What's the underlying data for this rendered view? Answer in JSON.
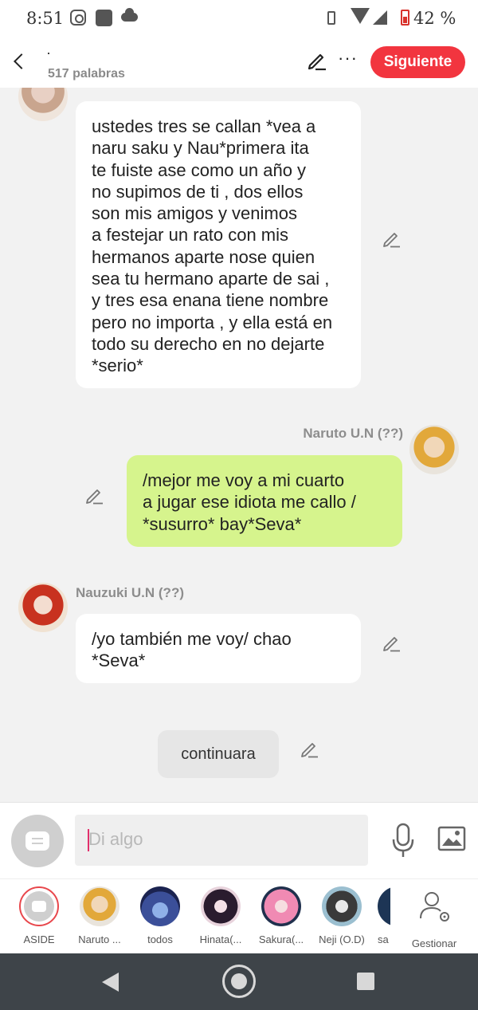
{
  "status_bar": {
    "time": "8:51",
    "battery": "42 %",
    "icons": [
      "instagram-icon",
      "app-icon",
      "cloud-icon",
      "vibrate-icon",
      "wifi-icon",
      "signal-icon",
      "battery-icon"
    ],
    "battery_color": "#d8322c"
  },
  "header": {
    "title": "·",
    "word_count": "517 palabras",
    "follow_label": "Siguiente",
    "follow_color": "#f2353f"
  },
  "messages": [
    {
      "author": "",
      "side": "left",
      "text": "ustedes tres se callan *vea a\nnaru saku y Nau*primera ita\nte fuiste ase como un año y\nno supimos de ti , dos ellos\nson mis amigos y venimos\na festejar un rato con mis\nhermanos aparte nose  quien\nsea tu hermano aparte de sai ,\ny tres esa enana tiene nombre\npero no importa , y ella está en\ntodo su derecho en no dejarte\n*serio*"
    },
    {
      "author": "Naruto U.N (??)",
      "side": "right",
      "text": "/mejor me voy a mi cuarto\na jugar ese idiota me callo /\n*susurro* bay*Seva*",
      "bubble_color": "#d6f48d"
    },
    {
      "author": "Nauzuki U.N (??)",
      "side": "left",
      "text": "/yo también me voy/ chao\n*Seva*"
    }
  ],
  "system_message": "continuara",
  "composer": {
    "placeholder": "Di algo"
  },
  "channels": [
    {
      "label": "ASIDE"
    },
    {
      "label": "Naruto ..."
    },
    {
      "label": "todos"
    },
    {
      "label": "Hinata(..."
    },
    {
      "label": "Sakura(..."
    },
    {
      "label": "Neji (O.D)"
    },
    {
      "label": "sa"
    },
    {
      "label": "Gestionar"
    }
  ]
}
